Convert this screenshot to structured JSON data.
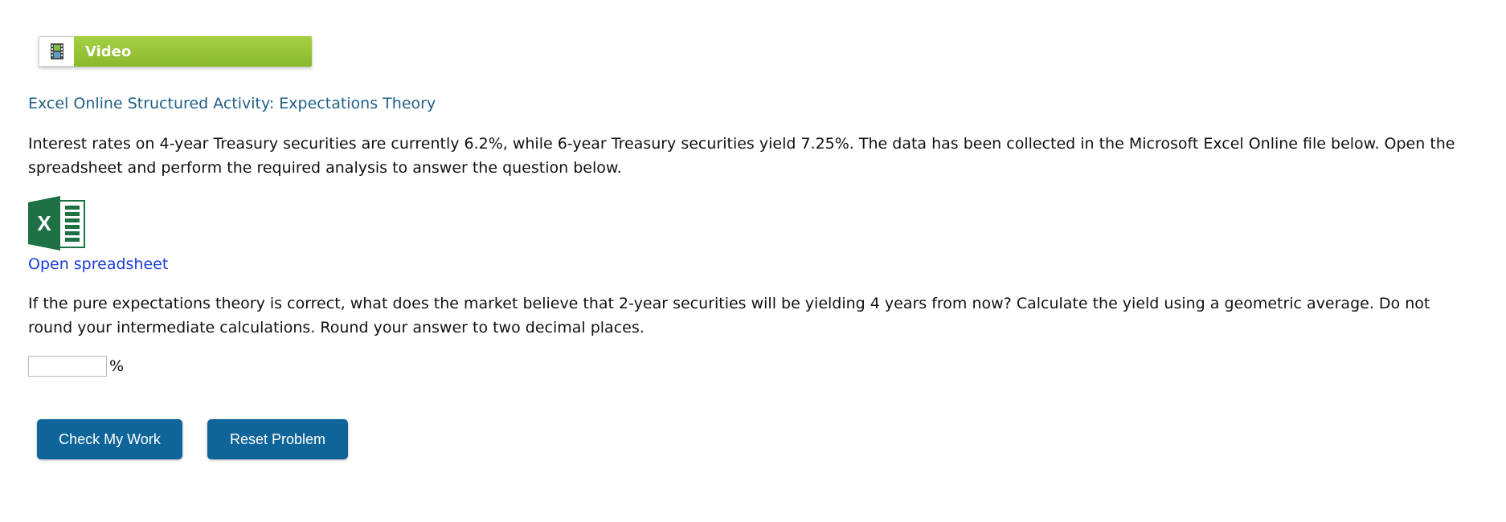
{
  "video": {
    "label": "Video",
    "icon": "film-icon"
  },
  "activity_title": "Excel Online Structured Activity: Expectations Theory",
  "intro_text": "Interest rates on 4-year Treasury securities are currently 6.2%, while 6-year Treasury securities yield 7.25%. The data has been collected in the Microsoft Excel Online file below. Open the spreadsheet and perform the required analysis to answer the question below.",
  "spreadsheet": {
    "icon": "excel-icon",
    "link_text": "Open spreadsheet"
  },
  "question_text": "If the pure expectations theory is correct, what does the market believe that 2-year securities will be yielding 4 years from now? Calculate the yield using a geometric average. Do not round your intermediate calculations. Round your answer to two decimal places.",
  "answer": {
    "value": "",
    "unit": "%"
  },
  "buttons": {
    "check_label": "Check My Work",
    "reset_label": "Reset Problem"
  },
  "colors": {
    "video_green": "#98c33a",
    "title_blue": "#1f5f86",
    "link_blue": "#1a3ddb",
    "button_blue": "#0f6599",
    "excel_green": "#1e7145"
  }
}
